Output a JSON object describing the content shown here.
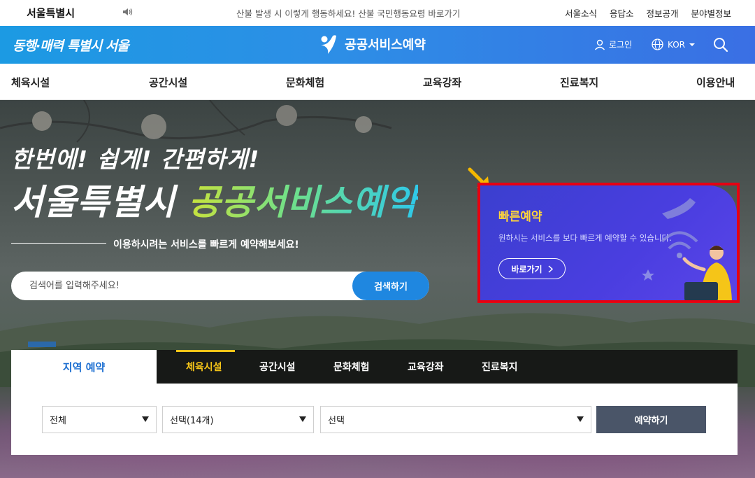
{
  "topbar": {
    "brand": "서울특별시",
    "speaker_icon": "speaker-icon",
    "notice": "산불 발생 시 이렇게 행동하세요! 산불 국민행동요령 바로가기",
    "utils": [
      "서울소식",
      "응답소",
      "정보공개",
      "분야별정보"
    ]
  },
  "header": {
    "slogan": "동행·매력 특별시 서울",
    "logo_text": "공공서비스예약",
    "login": "로그인",
    "lang": "KOR",
    "colors": {
      "from": "#1c9ae3",
      "to": "#3a6fe4"
    }
  },
  "gnb": {
    "items": [
      "체육시설",
      "공간시설",
      "문화체험",
      "교육강좌",
      "진료복지",
      "이용안내"
    ]
  },
  "hero": {
    "headline1": "한번에! 쉽게! 간편하게!",
    "headline2_white": "서울특별시 ",
    "headline2_accent": "공공서비스예약",
    "lead": "이용하시려는 서비스를 빠르게 예약해보세요!",
    "search": {
      "placeholder": "검색어를 입력해주세요!",
      "button": "검색하기"
    }
  },
  "quick": {
    "title": "빠른예약",
    "desc": "원하시는 서비스를 보다 빠르게 예약할 수 있습니다.",
    "button": "바로가기",
    "highlight_color": "#e60012"
  },
  "region": {
    "tab": "지역 예약",
    "categories": [
      "체육시설",
      "공간시설",
      "문화체험",
      "교육강좌",
      "진료복지"
    ],
    "active_category": "체육시설",
    "select1": "전체",
    "select2": "선택(14개)",
    "select3": "선택",
    "reserve_button": "예약하기"
  }
}
